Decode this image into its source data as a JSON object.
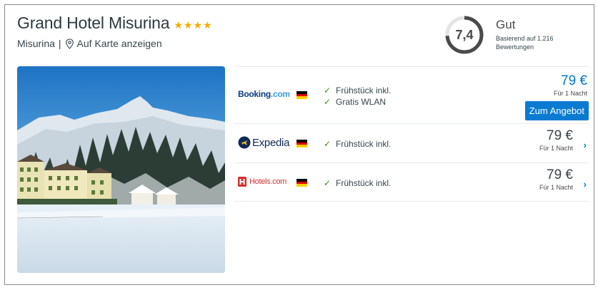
{
  "hotel": {
    "name": "Grand Hotel Misurina",
    "stars": 4,
    "location": "Misurina",
    "separator": "|",
    "map_link": "Auf Karte anzeigen"
  },
  "rating": {
    "score": "7,4",
    "score_fraction": 0.74,
    "label": "Gut",
    "based_on": "Basierend auf 1.216 Bewertungen"
  },
  "offers": [
    {
      "provider": "Booking.com",
      "provider_part1": "Booking",
      "provider_part2": ".com",
      "features": [
        "Frühstück inkl.",
        "Gratis WLAN"
      ],
      "price": "79 €",
      "per_night": "Für 1 Nacht",
      "button": "Zum Angebot"
    },
    {
      "provider": "Expedia",
      "features": [
        "Frühstück inkl."
      ],
      "price": "79 €",
      "per_night": "Für 1 Nacht"
    },
    {
      "provider": "Hotels.com",
      "features": [
        "Frühstück inkl."
      ],
      "price": "79 €",
      "per_night": "Für 1 Nacht"
    }
  ],
  "colors": {
    "accent": "#0077c8",
    "button": "#0a7bd1",
    "star": "#f6ab00",
    "check": "#3c8b1c"
  },
  "icons": {
    "star": "star-icon",
    "pin": "map-pin-icon",
    "check": "check-icon",
    "chevron": "chevron-right-icon",
    "flag": "german-flag-icon"
  }
}
